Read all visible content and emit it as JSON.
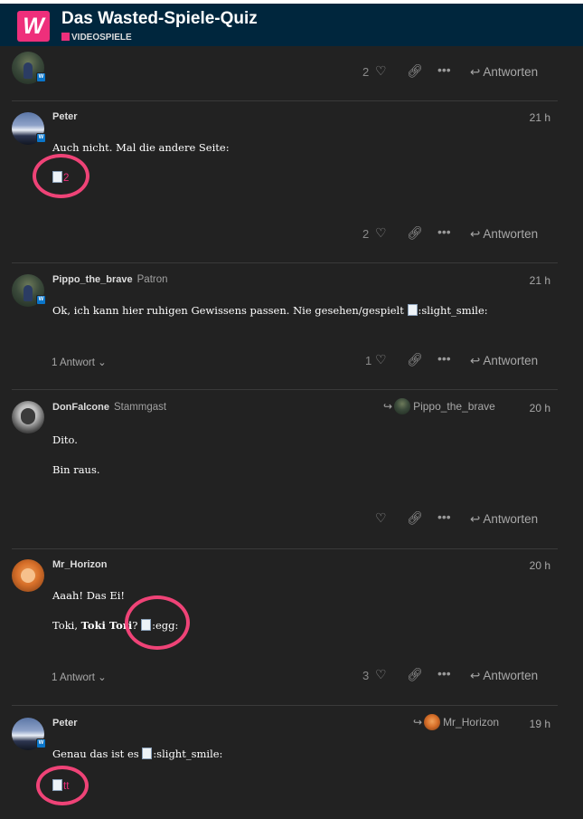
{
  "header": {
    "logo_letter": "W",
    "title": "Das Wasted-Spiele-Quiz",
    "category": "VIDEOSPIELE",
    "category_color": "#ee2f7b"
  },
  "icons": {
    "like": "heart-icon",
    "link": "link-icon",
    "more": "ellipsis-icon",
    "reply": "reply-arrow-icon",
    "chevron": "chevron-down-icon"
  },
  "posts": [
    {
      "avatar": "Pippo_the_brave",
      "likes": "2",
      "answer_label": "Antworten"
    },
    {
      "username": "Peter",
      "time": "21 h",
      "text": "Auch nicht. Mal die andere Seite:",
      "image_alt": "2",
      "likes": "2",
      "answer_label": "Antworten"
    },
    {
      "username": "Pippo_the_brave",
      "user_title": "Patron",
      "time": "21 h",
      "text": "Ok, ich kann hier ruhigen Gewissens passen. Nie gesehen/gespielt ",
      "emoji_alt": ":slight_smile:",
      "replies_label": "1 Antwort",
      "likes": "1",
      "answer_label": "Antworten"
    },
    {
      "username": "DonFalcone",
      "user_title": "Stammgast",
      "reply_to": "Pippo_the_brave",
      "time": "20 h",
      "text_lines": [
        "Dito.",
        "Bin raus."
      ],
      "likes": "",
      "answer_label": "Antworten"
    },
    {
      "username": "Mr_Horizon",
      "time": "20 h",
      "line1": "Aaah! Das Ei!",
      "line2_prefix": "Toki, ",
      "line2_bold": "Toki Tori",
      "line2_suffix": "? ",
      "emoji_alt": ":egg:",
      "replies_label": "1 Antwort",
      "likes": "3",
      "answer_label": "Antworten"
    },
    {
      "username": "Peter",
      "reply_to": "Mr_Horizon",
      "time": "19 h",
      "text": "Genau das ist es ",
      "emoji_alt": ":slight_smile:",
      "image_alt": "tt"
    }
  ]
}
